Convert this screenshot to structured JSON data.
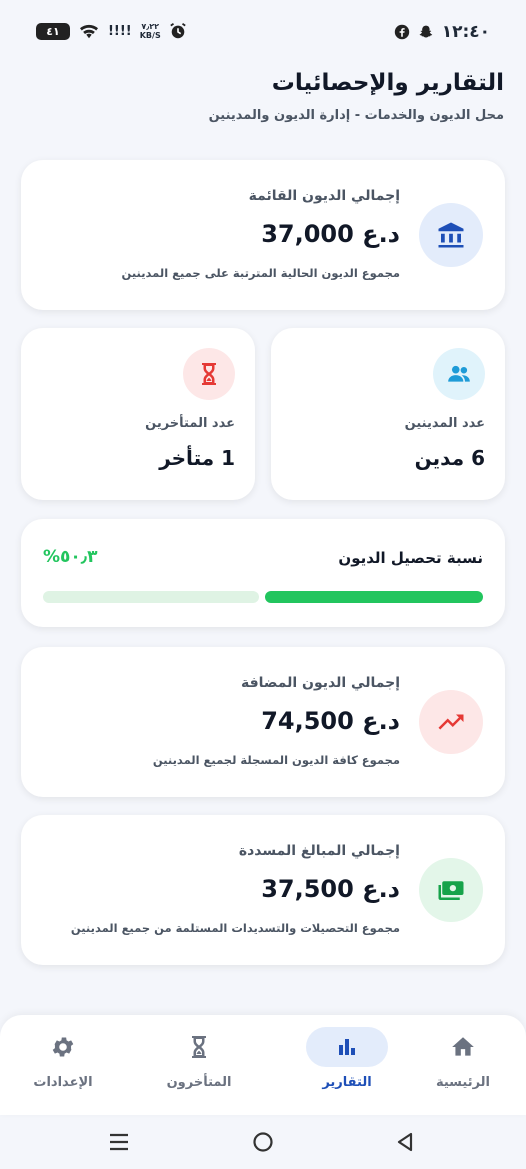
{
  "status_bar": {
    "time": "١٢:٤٠",
    "battery": "٤١",
    "net_speed_value": "٧٫٢٢",
    "net_speed_unit": "KB/S",
    "signal": "!!!!"
  },
  "header": {
    "title": "التقارير والإحصائيات",
    "subtitle": "محل الديون والخدمات - إدارة الديون والمدينين"
  },
  "total_debt_card": {
    "label": "إجمالي الديون القائمة",
    "value": "37,000 د.ع",
    "description": "مجموع الديون الحالية المترتبة على جميع المدينين",
    "icon": "bank-icon",
    "icon_color": "#1e4fb7",
    "icon_bg": "#e3ecfb"
  },
  "debtors_card": {
    "label": "عدد المدينين",
    "value": "6 مدين",
    "icon": "people-icon",
    "icon_color": "#1e9bd7",
    "icon_bg": "#e0f3fb"
  },
  "overdue_card": {
    "label": "عدد المتأخرين",
    "value": "1 متأخر",
    "icon": "hourglass-icon",
    "icon_color": "#e53935",
    "icon_bg": "#fde7e7"
  },
  "collection_card": {
    "label": "نسبة تحصيل الديون",
    "percent_text": "%٥٠٫٣",
    "percent_value": 50.3,
    "fill_color": "#22c55e",
    "track_color": "#dff3e4"
  },
  "added_debts_card": {
    "label": "إجمالي الديون المضافة",
    "value": "74,500 د.ع",
    "description": "مجموع كافة الديون المسجلة لجميع المدينين",
    "icon": "trending-up-icon",
    "icon_color": "#e53935",
    "icon_bg": "#fde7e7"
  },
  "paid_card": {
    "label": "إجمالي المبالغ المسددة",
    "value": "37,500 د.ع",
    "description": "مجموع التحصيلات والتسديدات المستلمة من جميع المدينين",
    "icon": "money-icon",
    "icon_color": "#16a34a",
    "icon_bg": "#e3f6e9"
  },
  "bottom_nav": {
    "items": [
      {
        "label": "الرئيسية",
        "icon": "home-icon"
      },
      {
        "label": "التقارير",
        "icon": "bar-chart-icon",
        "active": true
      },
      {
        "label": "المتأخرون",
        "icon": "hourglass-icon"
      },
      {
        "label": "الإعدادات",
        "icon": "gear-icon"
      }
    ]
  },
  "colors": {
    "accent": "#1e4fb7",
    "background": "#f4f6fb",
    "success": "#22c55e",
    "danger": "#e53935"
  }
}
